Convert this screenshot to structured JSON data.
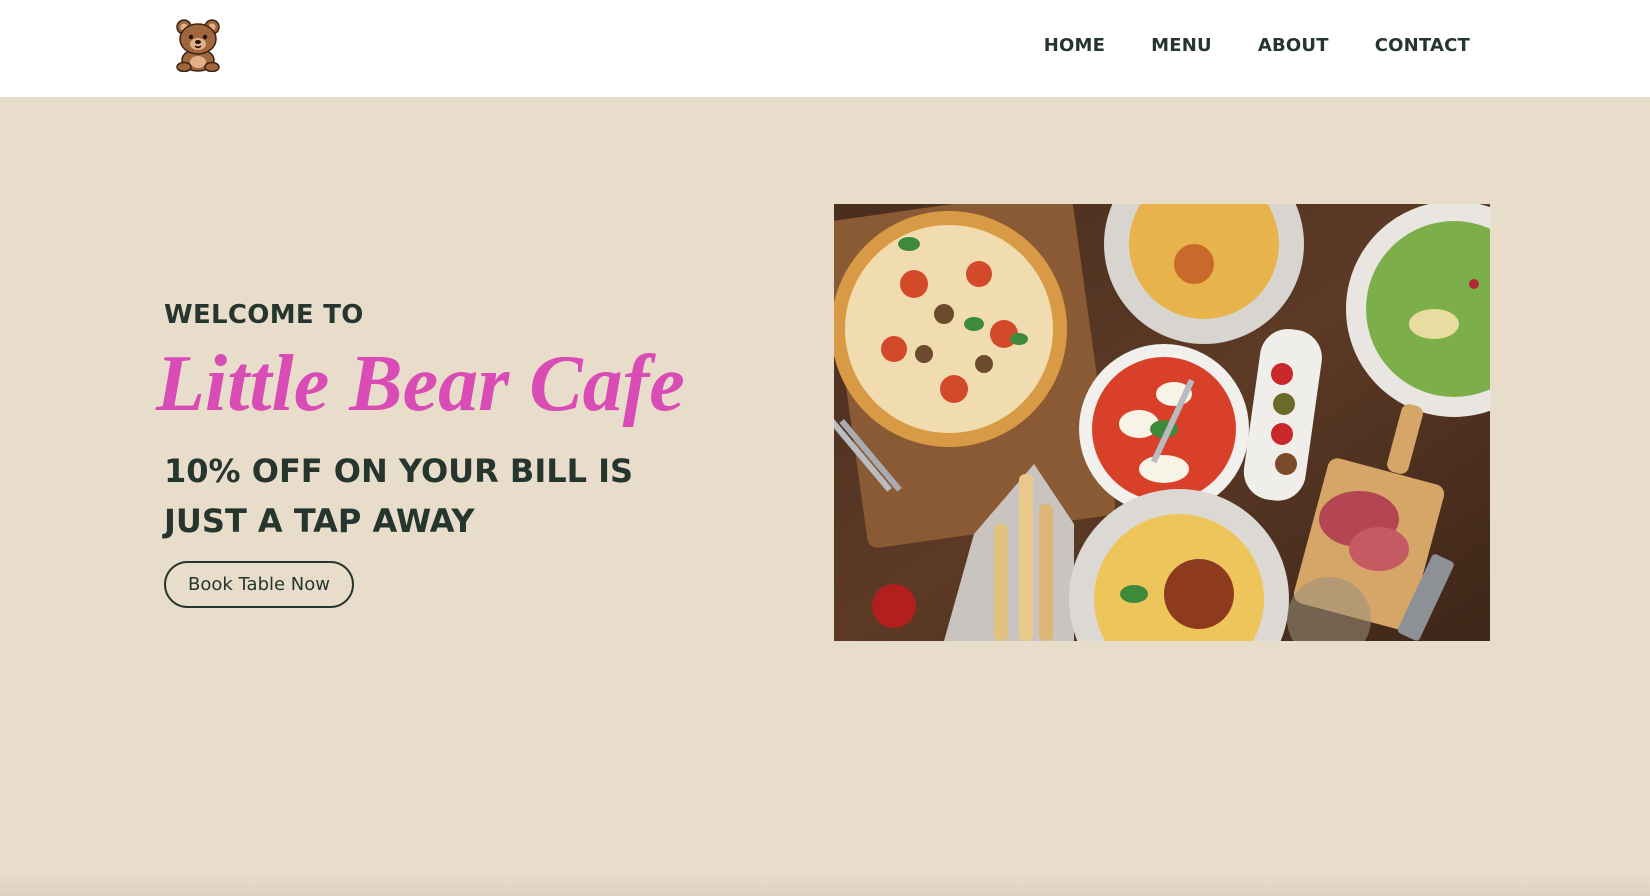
{
  "header": {
    "logo_name": "teddy-bear-logo",
    "nav": [
      {
        "label": "HOME"
      },
      {
        "label": "MENU"
      },
      {
        "label": "ABOUT"
      },
      {
        "label": "CONTACT"
      }
    ]
  },
  "hero": {
    "welcome": "WELCOME TO",
    "cafe_name": "Little Bear Cafe",
    "offer_line1": "10% OFF ON YOUR BILL IS",
    "offer_line2": "JUST A TAP AWAY",
    "cta_label": "Book Table Now"
  },
  "colors": {
    "hero_background": "#e8dcca",
    "text_dark": "#26362f",
    "accent_pink": "#d94bb5",
    "header_background": "#ffffff"
  }
}
